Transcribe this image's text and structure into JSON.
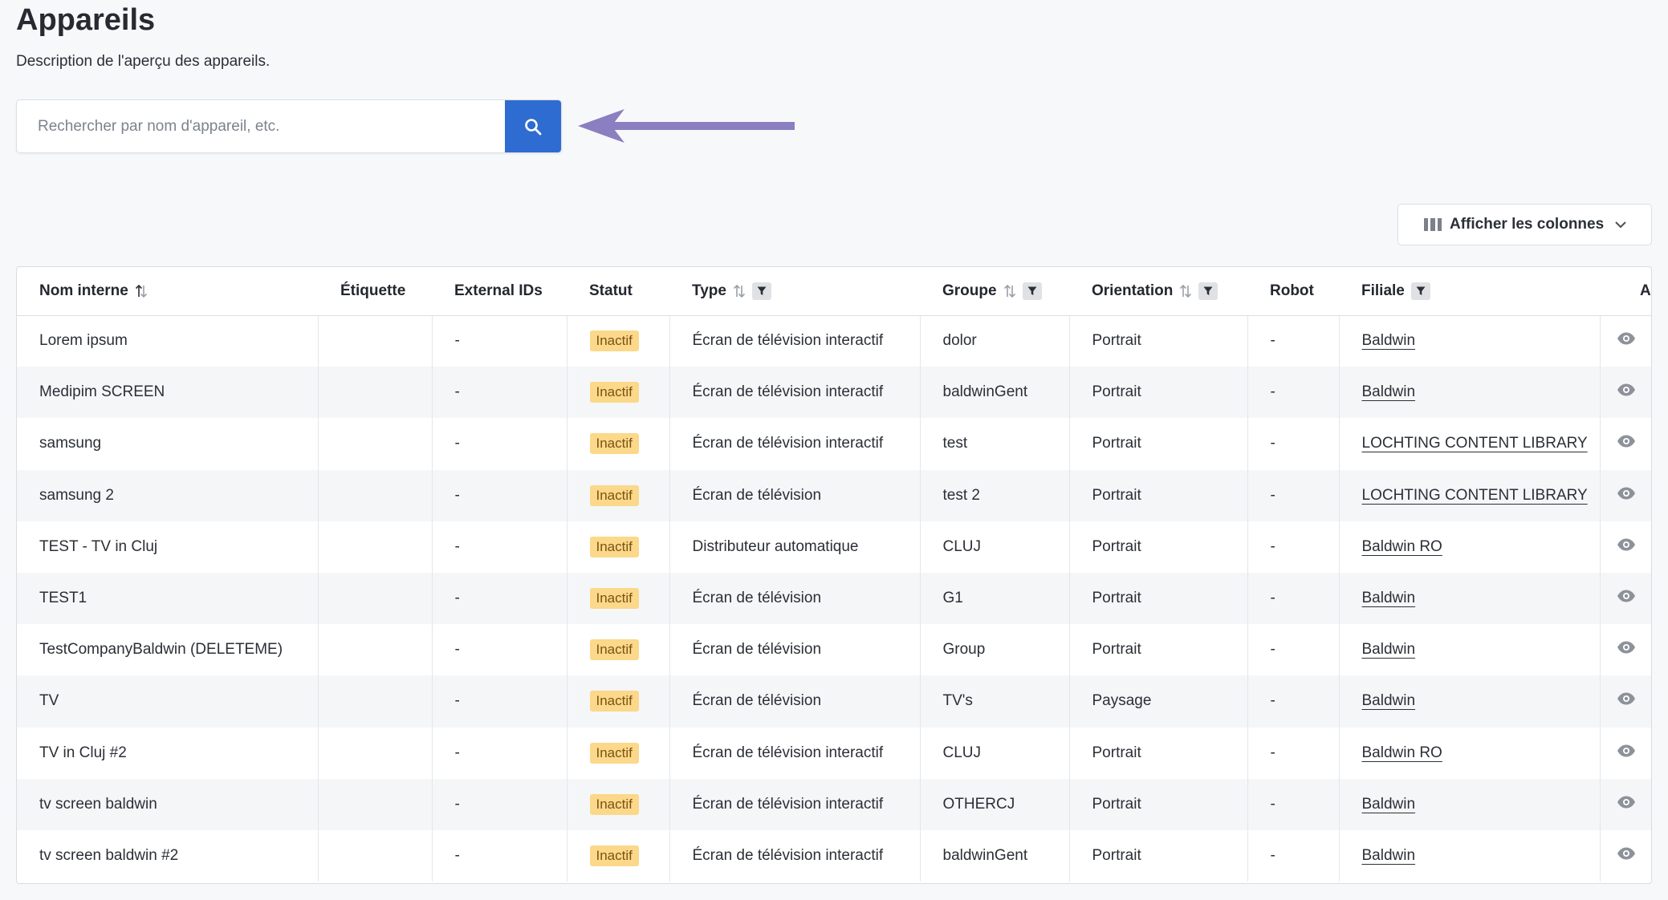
{
  "page": {
    "title": "Appareils",
    "description": "Description de l'aperçu des appareils."
  },
  "search": {
    "placeholder": "Rechercher par nom d'appareil, etc.",
    "value": "",
    "button_icon": "search-icon"
  },
  "annotation": {
    "arrow_color": "#8b7fc1"
  },
  "columns_button": {
    "label": "Afficher les colonnes",
    "icon": "columns-icon"
  },
  "colors": {
    "primary": "#2f6cd1",
    "badge_bg": "#fbd88a",
    "badge_text": "#7a5312"
  },
  "table": {
    "headers": {
      "name": "Nom interne",
      "label": "Étiquette",
      "external_ids": "External IDs",
      "status": "Statut",
      "type": "Type",
      "group": "Groupe",
      "orientation": "Orientation",
      "robot": "Robot",
      "branch": "Filiale",
      "actions": "A"
    },
    "rows": [
      {
        "name": "Lorem ipsum",
        "label": "",
        "external_ids": "-",
        "status": "Inactif",
        "type": "Écran de télévision interactif",
        "group": "dolor",
        "orientation": "Portrait",
        "robot": "-",
        "branch": "Baldwin"
      },
      {
        "name": "Medipim SCREEN",
        "label": "",
        "external_ids": "-",
        "status": "Inactif",
        "type": "Écran de télévision interactif",
        "group": "baldwinGent",
        "orientation": "Portrait",
        "robot": "-",
        "branch": "Baldwin"
      },
      {
        "name": "samsung",
        "label": "",
        "external_ids": "-",
        "status": "Inactif",
        "type": "Écran de télévision interactif",
        "group": "test",
        "orientation": "Portrait",
        "robot": "-",
        "branch": "LOCHTING CONTENT LIBRARY"
      },
      {
        "name": "samsung 2",
        "label": "",
        "external_ids": "-",
        "status": "Inactif",
        "type": "Écran de télévision",
        "group": "test 2",
        "orientation": "Portrait",
        "robot": "-",
        "branch": "LOCHTING CONTENT LIBRARY"
      },
      {
        "name": "TEST - TV in Cluj",
        "label": "",
        "external_ids": "-",
        "status": "Inactif",
        "type": "Distributeur automatique",
        "group": "CLUJ",
        "orientation": "Portrait",
        "robot": "-",
        "branch": "Baldwin RO"
      },
      {
        "name": "TEST1",
        "label": "",
        "external_ids": "-",
        "status": "Inactif",
        "type": "Écran de télévision",
        "group": "G1",
        "orientation": "Portrait",
        "robot": "-",
        "branch": "Baldwin"
      },
      {
        "name": "TestCompanyBaldwin (DELETEME)",
        "label": "",
        "external_ids": "-",
        "status": "Inactif",
        "type": "Écran de télévision",
        "group": "Group",
        "orientation": "Portrait",
        "robot": "-",
        "branch": "Baldwin"
      },
      {
        "name": "TV",
        "label": "",
        "external_ids": "-",
        "status": "Inactif",
        "type": "Écran de télévision",
        "group": "TV's",
        "orientation": "Paysage",
        "robot": "-",
        "branch": "Baldwin"
      },
      {
        "name": "TV in Cluj #2",
        "label": "",
        "external_ids": "-",
        "status": "Inactif",
        "type": "Écran de télévision interactif",
        "group": "CLUJ",
        "orientation": "Portrait",
        "robot": "-",
        "branch": "Baldwin RO"
      },
      {
        "name": "tv screen baldwin",
        "label": "",
        "external_ids": "-",
        "status": "Inactif",
        "type": "Écran de télévision interactif",
        "group": "OTHERCJ",
        "orientation": "Portrait",
        "robot": "-",
        "branch": "Baldwin"
      },
      {
        "name": "tv screen baldwin #2",
        "label": "",
        "external_ids": "-",
        "status": "Inactif",
        "type": "Écran de télévision interactif",
        "group": "baldwinGent",
        "orientation": "Portrait",
        "robot": "-",
        "branch": "Baldwin"
      }
    ]
  }
}
